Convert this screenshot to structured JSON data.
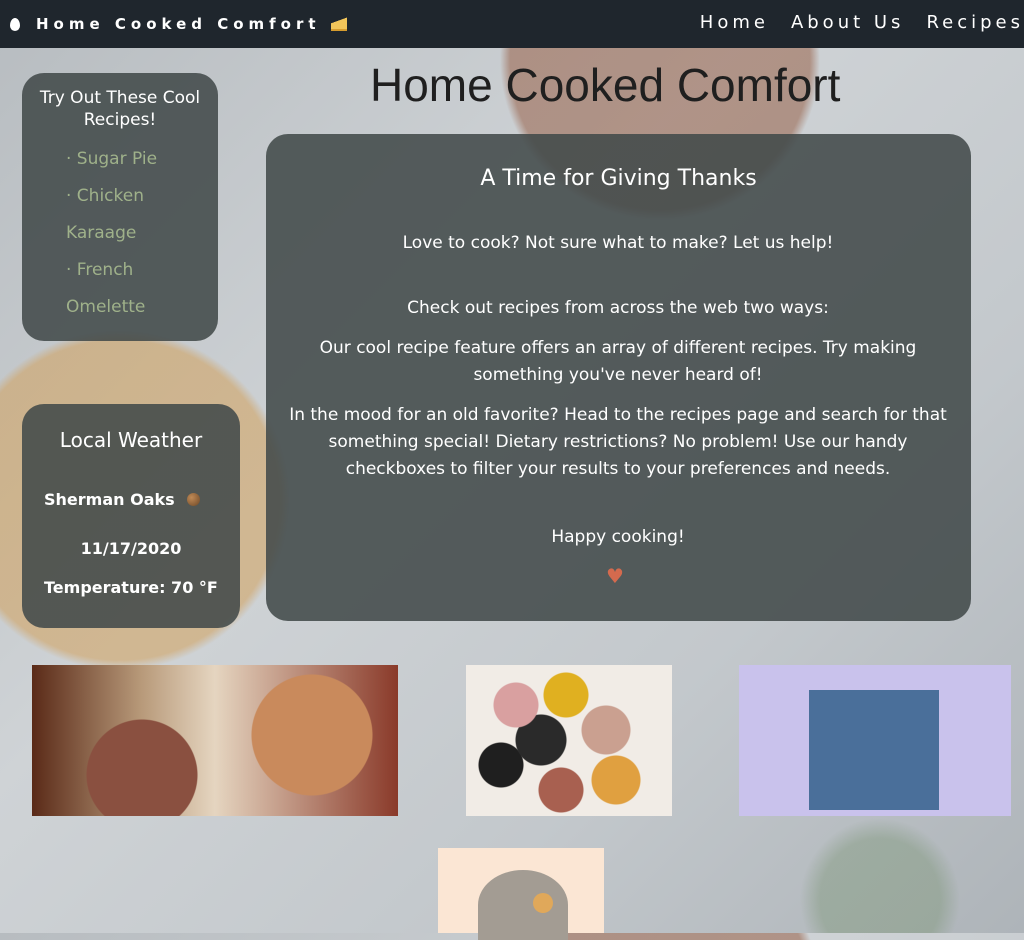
{
  "nav": {
    "brand": "Home Cooked Comfort",
    "brand_icon": "egg-icon",
    "brand_icon_right": "cheese-icon",
    "links": [
      "Home",
      "About Us",
      "Recipes"
    ]
  },
  "page_title": "Home Cooked Comfort",
  "recipes_panel": {
    "title": "Try Out These Cool Recipes!",
    "items": [
      "· Sugar Pie",
      "· Chicken Karaage",
      "· French Omelette"
    ]
  },
  "weather": {
    "title": "Local Weather",
    "city": "Sherman Oaks",
    "icon": "weather-icon",
    "date": "11/17/2020",
    "temperature": "Temperature: 70 °F"
  },
  "main": {
    "heading": "A Time for Giving Thanks",
    "p1": "Love to cook? Not sure what to make? Let us help!",
    "p2": "Check out recipes from across the web two ways:",
    "p3": "Our cool recipe feature offers an array of different recipes. Try making something you've never heard of!",
    "p4": "In the mood for an old favorite? Head to the recipes page and search for that something special! Dietary restrictions? No problem! Use our handy checkboxes to filter your results to your preferences and needs.",
    "p5": "Happy cooking!",
    "heart": "♥"
  },
  "colors": {
    "nav_bg": "#1f262d",
    "panel_bg": "#424a4a",
    "link_green": "#9fb18a",
    "heart": "#d46a4e"
  }
}
